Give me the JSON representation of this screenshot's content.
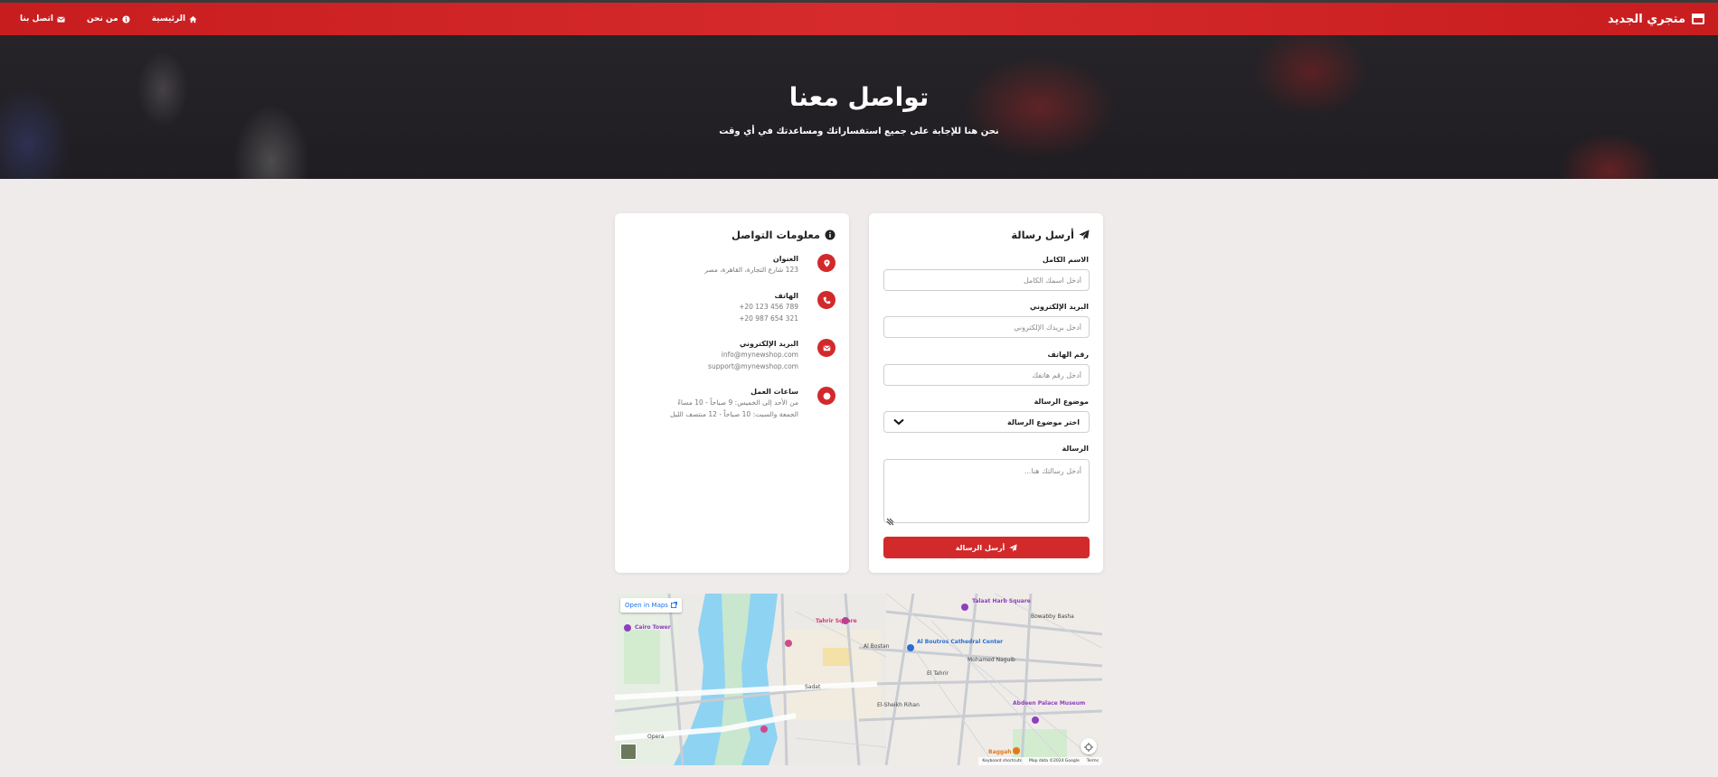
{
  "nav": {
    "brand": "متجري الجديد",
    "links": {
      "home": "الرئيسية",
      "about": "من نحن",
      "contact": "اتصل بنا"
    }
  },
  "hero": {
    "title": "تواصل معنا",
    "subtitle": "نحن هنا للإجابة على جميع استفساراتك ومساعدتك في أي وقت"
  },
  "form": {
    "title": "أرسل رسالة",
    "name_label": "الاسم الكامل",
    "name_placeholder": "أدخل اسمك الكامل",
    "email_label": "البريد الإلكتروني",
    "email_placeholder": "أدخل بريدك الإلكتروني",
    "phone_label": "رقم الهاتف",
    "phone_placeholder": "أدخل رقم هاتفك",
    "subject_label": "موضوع الرسالة",
    "subject_selected": "اختر موضوع الرسالة",
    "message_label": "الرسالة",
    "message_placeholder": "أدخل رسالتك هنا...",
    "submit_label": "أرسل الرسالة"
  },
  "info": {
    "title": "معلومات التواصل",
    "address": {
      "label": "العنوان",
      "line1": "123 شارع التجارة، القاهرة، مصر"
    },
    "phone": {
      "label": "الهاتف",
      "line1": "+20 123 456 789",
      "line2": "+20 987 654 321"
    },
    "email": {
      "label": "البريد الإلكتروني",
      "line1": "info@mynewshop.com",
      "line2": "support@mynewshop.com"
    },
    "hours": {
      "label": "ساعات العمل",
      "line1": "من الأحد إلى الخميس: 9 صباحاً - 10 مساءً",
      "line2": "الجمعة والسبت: 10 صباحاً - 12 منتصف الليل"
    }
  },
  "map": {
    "open_in_maps": "Open in Maps",
    "labels": {
      "tahrir": "Tahrir Square",
      "talaat": "Talaat Harb Square",
      "cairo_tower": "Cairo Tower",
      "cathedral": "Al Boutros Cathedral Center",
      "mohamed_naguib": "Mohamed Naguib",
      "bowabby": "Bowabby Basha",
      "abdeen": "Abdeen Palace Museum",
      "sadat": "Sadat",
      "el_tahrir": "El Tahrir",
      "opera": "Opera",
      "baggah": "Baggah",
      "el_sheikh": "El-Sheikh Rihan",
      "el_bostan": "Al Bostan"
    },
    "footer": {
      "shortcuts": "Keyboard shortcuts",
      "data": "Map data ©2024 Google",
      "terms": "Terms"
    }
  },
  "colors": {
    "accent": "#d22a2b",
    "navbar": "#c81d1f",
    "background": "#efebea"
  },
  "icons": {
    "brand": "store-icon",
    "home": "home-icon",
    "about": "info-circle-icon",
    "contact": "envelope-icon",
    "form_title": "paper-plane-icon",
    "info_title": "info-circle-icon",
    "address": "map-marker-icon",
    "phone": "phone-icon",
    "email": "envelope-icon",
    "hours": "clock-icon"
  }
}
